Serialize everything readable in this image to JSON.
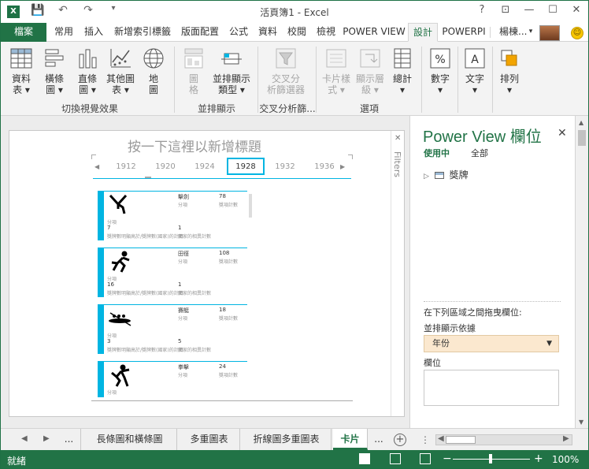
{
  "window": {
    "title": "活頁簿1 - Excel",
    "controls": [
      "?",
      "⊡",
      "—",
      "☐",
      "✕"
    ]
  },
  "qat": [
    "save-icon",
    "undo-icon",
    "redo-icon",
    "customize-icon"
  ],
  "tabs": [
    {
      "label": "檔案"
    },
    {
      "label": "常用"
    },
    {
      "label": "插入"
    },
    {
      "label": "新增索引標籤"
    },
    {
      "label": "版面配置"
    },
    {
      "label": "公式"
    },
    {
      "label": "資料"
    },
    {
      "label": "校閱"
    },
    {
      "label": "檢視"
    },
    {
      "label": "POWER VIEW"
    },
    {
      "label": "設計"
    },
    {
      "label": "POWERPI"
    }
  ],
  "user": {
    "name": "楊棟..."
  },
  "ribbon": {
    "buttons": [
      {
        "l1": "資料",
        "l2": "表 ▾",
        "icon": "table-icon"
      },
      {
        "l1": "橫條",
        "l2": "圖 ▾",
        "icon": "bar-chart-icon"
      },
      {
        "l1": "直條",
        "l2": "圖 ▾",
        "icon": "column-chart-icon"
      },
      {
        "l1": "其他圖",
        "l2": "表 ▾",
        "icon": "line-chart-icon"
      },
      {
        "l1": "地",
        "l2": "圖",
        "icon": "map-icon"
      },
      {
        "l1": "圖",
        "l2": "格",
        "icon": "tiles-icon"
      },
      {
        "l1": "並排顯示",
        "l2": "類型 ▾",
        "icon": "tile-type-icon"
      },
      {
        "l1": "交叉分",
        "l2": "析篩選器",
        "icon": "slicer-icon"
      },
      {
        "l1": "卡片樣",
        "l2": "式 ▾",
        "icon": "card-style-icon"
      },
      {
        "l1": "顯示層",
        "l2": "級 ▾",
        "icon": "show-levels-icon"
      },
      {
        "l1": "總計",
        "l2": "▾",
        "icon": "totals-icon"
      },
      {
        "l1": "數字",
        "l2": "▾",
        "icon": "percent-icon"
      },
      {
        "l1": "文字",
        "l2": "▾",
        "icon": "text-icon"
      },
      {
        "l1": "排列",
        "l2": "▾",
        "icon": "arrange-icon"
      }
    ],
    "groups": [
      "切換視覺效果",
      "並排顯示",
      "交叉分析篩...",
      "選項"
    ]
  },
  "canvas": {
    "title_placeholder": "按一下這裡以新增標題",
    "filters_label": "Filters",
    "years": [
      "1912",
      "1920",
      "1924",
      "1928",
      "1932",
      "1936"
    ],
    "selected_year": "1928",
    "cards": [
      {
        "icon": "fencing-icon",
        "sport": "擊劍",
        "count": "78",
        "count_label": "獎項計數",
        "sport_label": "分項",
        "sub_label": "分項數目",
        "a": "7",
        "b": "1",
        "a_label": "獎牌數明顯高於/獎牌數(國家)的計數",
        "b_label": "國家的相異計數"
      },
      {
        "icon": "athletics-icon",
        "sport": "田徑",
        "count": "108",
        "count_label": "獎項計數",
        "sport_label": "分項",
        "sub_label": "分項數目",
        "a": "16",
        "b": "1",
        "a_label": "獎牌數明顯高於/獎牌數(國家)的計數",
        "b_label": "國家的相異計數"
      },
      {
        "icon": "rowing-icon",
        "sport": "賽艇",
        "count": "18",
        "count_label": "獎項計數",
        "sport_label": "分項",
        "sub_label": "分項數目",
        "a": "3",
        "b": "5",
        "a_label": "獎牌數明顯高於/獎牌數(國家)的計數",
        "b_label": "國家的相異計數"
      },
      {
        "icon": "boxing-icon",
        "sport": "拳擊",
        "count": "24",
        "count_label": "獎項計數",
        "sport_label": "分項",
        "sub_label": "分項數目",
        "a": "",
        "b": "",
        "a_label": "",
        "b_label": ""
      }
    ]
  },
  "fields": {
    "title": "Power View 欄位",
    "tab_in_use": "使用中",
    "tab_all": "全部",
    "table_name": "獎牌",
    "drag_hint": "在下列區域之間拖曳欄位:",
    "tile_by_label": "並排顯示依據",
    "tile_by_value": "年份",
    "fields_label": "欄位"
  },
  "sheets": {
    "nav_more": "...",
    "tabs": [
      "長條圖和橫條圖",
      "多重圖表",
      "折線圖多重圖表",
      "卡片"
    ],
    "active": "卡片",
    "more_after": "..."
  },
  "status": {
    "ready": "就緒",
    "zoom": "100%"
  },
  "colors": {
    "excel_green": "#217346",
    "powerview_accent": "#00b5e2"
  }
}
